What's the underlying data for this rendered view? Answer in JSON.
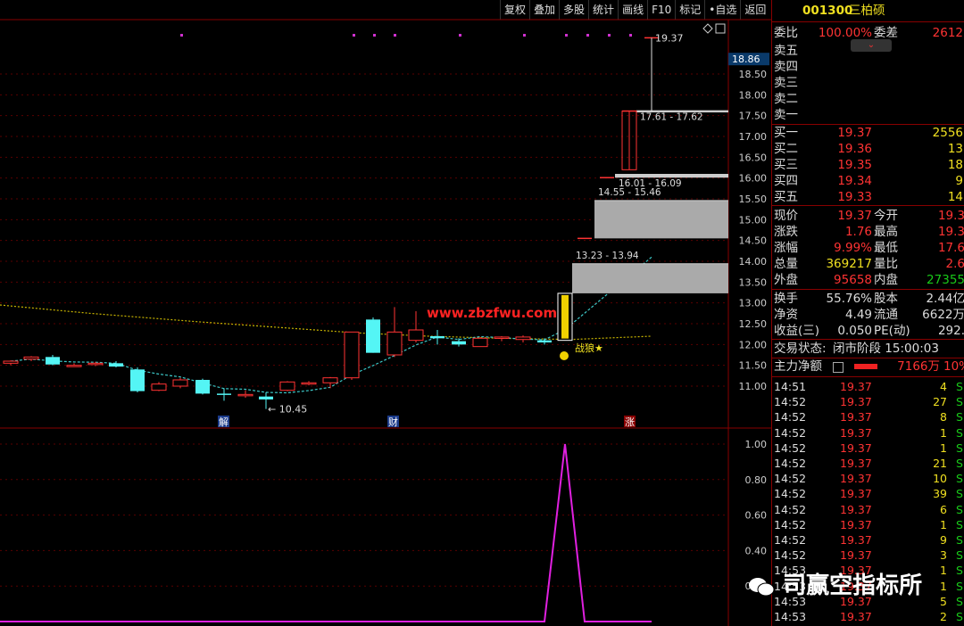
{
  "toolbar": [
    "复权",
    "叠加",
    "多股",
    "统计",
    "画线",
    "F10",
    "标记",
    "•自选",
    "返回"
  ],
  "stock": {
    "code": "001300",
    "name": "三柏硕"
  },
  "order_book": {
    "weibi_label": "委比",
    "weibi_value": "100.00%",
    "weicha_label": "委差",
    "weicha_value": "2612",
    "sells": [
      {
        "label": "卖五"
      },
      {
        "label": "卖四"
      },
      {
        "label": "卖三"
      },
      {
        "label": "卖二"
      },
      {
        "label": "卖一"
      }
    ],
    "buys": [
      {
        "label": "买一",
        "price": "19.37",
        "vol": "2556"
      },
      {
        "label": "买二",
        "price": "19.36",
        "vol": "13"
      },
      {
        "label": "买三",
        "price": "19.35",
        "vol": "18"
      },
      {
        "label": "买四",
        "price": "19.34",
        "vol": "9"
      },
      {
        "label": "买五",
        "price": "19.33",
        "vol": "14"
      }
    ]
  },
  "quote": [
    {
      "l1": "现价",
      "v1": "19.37",
      "l2": "今开",
      "v2": "19.3"
    },
    {
      "l1": "涨跌",
      "v1": "1.76",
      "l2": "最高",
      "v2": "19.3"
    },
    {
      "l1": "涨幅",
      "v1": "9.99%",
      "l2": "最低",
      "v2": "17.6"
    },
    {
      "l1": "总量",
      "v1": "369217",
      "l2": "量比",
      "v2": "2.6"
    },
    {
      "l1": "外盘",
      "v1": "95658",
      "l2": "内盘",
      "v2": "27355"
    }
  ],
  "fundamentals": [
    {
      "l1": "换手",
      "v1": "55.76%",
      "l2": "股本",
      "v2": "2.44亿"
    },
    {
      "l1": "净资",
      "v1": "4.49",
      "l2": "流通",
      "v2": "6622万"
    },
    {
      "l1": "收益(三)",
      "v1": "0.050",
      "l2": "PE(动)",
      "v2": "292."
    }
  ],
  "status": {
    "label": "交易状态:",
    "value": "闭市阶段 15:00:03"
  },
  "net_flow": {
    "label": "主力净额",
    "value": "7166万",
    "pct": "10%"
  },
  "ticks": [
    {
      "t": "14:51",
      "p": "19.37",
      "v": "4",
      "s": "S"
    },
    {
      "t": "14:52",
      "p": "19.37",
      "v": "27",
      "s": "S"
    },
    {
      "t": "14:52",
      "p": "19.37",
      "v": "8",
      "s": "S"
    },
    {
      "t": "14:52",
      "p": "19.37",
      "v": "1",
      "s": "S"
    },
    {
      "t": "14:52",
      "p": "19.37",
      "v": "1",
      "s": "S"
    },
    {
      "t": "14:52",
      "p": "19.37",
      "v": "21",
      "s": "S"
    },
    {
      "t": "14:52",
      "p": "19.37",
      "v": "10",
      "s": "S"
    },
    {
      "t": "14:52",
      "p": "19.37",
      "v": "39",
      "s": "S"
    },
    {
      "t": "14:52",
      "p": "19.37",
      "v": "6",
      "s": "S"
    },
    {
      "t": "14:52",
      "p": "19.37",
      "v": "1",
      "s": "S"
    },
    {
      "t": "14:52",
      "p": "19.37",
      "v": "9",
      "s": "S"
    },
    {
      "t": "14:52",
      "p": "19.37",
      "v": "3",
      "s": "S"
    },
    {
      "t": "14:53",
      "p": "19.37",
      "v": "1",
      "s": "S"
    },
    {
      "t": "14:53",
      "p": "19.37",
      "v": "1",
      "s": "S"
    },
    {
      "t": "14:53",
      "p": "19.37",
      "v": "5",
      "s": "S"
    },
    {
      "t": "14:53",
      "p": "19.37",
      "v": "2",
      "s": "S"
    }
  ],
  "watermark": "司赢空指标所",
  "chart_data": {
    "type": "candlestick",
    "price_axis_ticks": [
      "18.50",
      "18.00",
      "17.50",
      "17.00",
      "16.50",
      "16.00",
      "15.50",
      "15.00",
      "14.50",
      "14.00",
      "13.50",
      "13.00",
      "12.50",
      "12.00",
      "11.50",
      "11.00"
    ],
    "current_price_tag": "18.86",
    "ylim": [
      10.2,
      19.8
    ],
    "candles": [
      {
        "o": 11.55,
        "h": 11.62,
        "l": 11.5,
        "c": 11.6
      },
      {
        "o": 11.65,
        "h": 11.72,
        "l": 11.6,
        "c": 11.7
      },
      {
        "o": 11.7,
        "h": 11.75,
        "l": 11.5,
        "c": 11.52
      },
      {
        "o": 11.5,
        "h": 11.55,
        "l": 11.46,
        "c": 11.5
      },
      {
        "o": 11.52,
        "h": 11.58,
        "l": 11.48,
        "c": 11.55
      },
      {
        "o": 11.55,
        "h": 11.6,
        "l": 11.45,
        "c": 11.47
      },
      {
        "o": 11.4,
        "h": 11.45,
        "l": 10.85,
        "c": 10.88
      },
      {
        "o": 10.9,
        "h": 11.1,
        "l": 10.88,
        "c": 11.05
      },
      {
        "o": 11.0,
        "h": 11.2,
        "l": 10.95,
        "c": 11.15
      },
      {
        "o": 11.15,
        "h": 11.18,
        "l": 10.8,
        "c": 10.82
      },
      {
        "o": 10.82,
        "h": 10.95,
        "l": 10.65,
        "c": 10.8
      },
      {
        "o": 10.8,
        "h": 10.9,
        "l": 10.72,
        "c": 10.8
      },
      {
        "o": 10.75,
        "h": 10.85,
        "l": 10.45,
        "c": 10.68
      },
      {
        "o": 10.9,
        "h": 11.12,
        "l": 10.88,
        "c": 11.1
      },
      {
        "o": 11.08,
        "h": 11.12,
        "l": 11.02,
        "c": 11.08
      },
      {
        "o": 11.08,
        "h": 11.22,
        "l": 10.95,
        "c": 11.2
      },
      {
        "o": 11.2,
        "h": 12.3,
        "l": 11.15,
        "c": 12.3
      },
      {
        "o": 12.6,
        "h": 12.65,
        "l": 11.8,
        "c": 11.8
      },
      {
        "o": 11.75,
        "h": 12.9,
        "l": 11.7,
        "c": 12.3
      },
      {
        "o": 12.1,
        "h": 12.8,
        "l": 12.05,
        "c": 12.35
      },
      {
        "o": 12.2,
        "h": 12.35,
        "l": 12.0,
        "c": 12.15
      },
      {
        "o": 12.08,
        "h": 12.15,
        "l": 11.95,
        "c": 12.0
      },
      {
        "o": 11.95,
        "h": 12.18,
        "l": 11.95,
        "c": 12.15
      },
      {
        "o": 12.15,
        "h": 12.2,
        "l": 12.08,
        "c": 12.18
      },
      {
        "o": 12.12,
        "h": 12.22,
        "l": 12.05,
        "c": 12.18
      },
      {
        "o": 12.1,
        "h": 12.15,
        "l": 12.0,
        "c": 12.05
      },
      {
        "o": 12.1,
        "h": 13.23,
        "l": 12.1,
        "c": 13.23
      },
      {
        "o": 14.55,
        "h": 14.55,
        "l": 14.55,
        "c": 14.55
      },
      {
        "o": 16.01,
        "h": 16.01,
        "l": 16.01,
        "c": 16.01
      },
      {
        "o": 16.2,
        "h": 17.61,
        "l": 16.2,
        "c": 17.61
      },
      {
        "o": 19.37,
        "h": 19.37,
        "l": 19.37,
        "c": 19.37
      }
    ],
    "gap_zones": [
      {
        "low": 13.23,
        "high": 13.94,
        "label": "13.23 - 13.94"
      },
      {
        "low": 14.55,
        "high": 15.46,
        "label": "14.55 - 15.46"
      },
      {
        "low": 16.01,
        "high": 16.09,
        "label": "16.01 - 16.09"
      },
      {
        "low": 17.61,
        "high": 17.62,
        "label": "17.61 - 17.62"
      }
    ],
    "annotations": [
      "19.37",
      "10.45",
      "战狼",
      "www.zbzfwu.com",
      "解",
      "财",
      "涨"
    ],
    "indicator": {
      "axis_ticks": [
        "1.00",
        "0.80",
        "0.60",
        "0.40",
        "0.20"
      ],
      "values": [
        0,
        0,
        0,
        0,
        0,
        0,
        0,
        0,
        0,
        0,
        0,
        0,
        0,
        0,
        0,
        0,
        0,
        0,
        0,
        0,
        0,
        0,
        0,
        0,
        0,
        0,
        1,
        0,
        0,
        0,
        0
      ]
    }
  }
}
